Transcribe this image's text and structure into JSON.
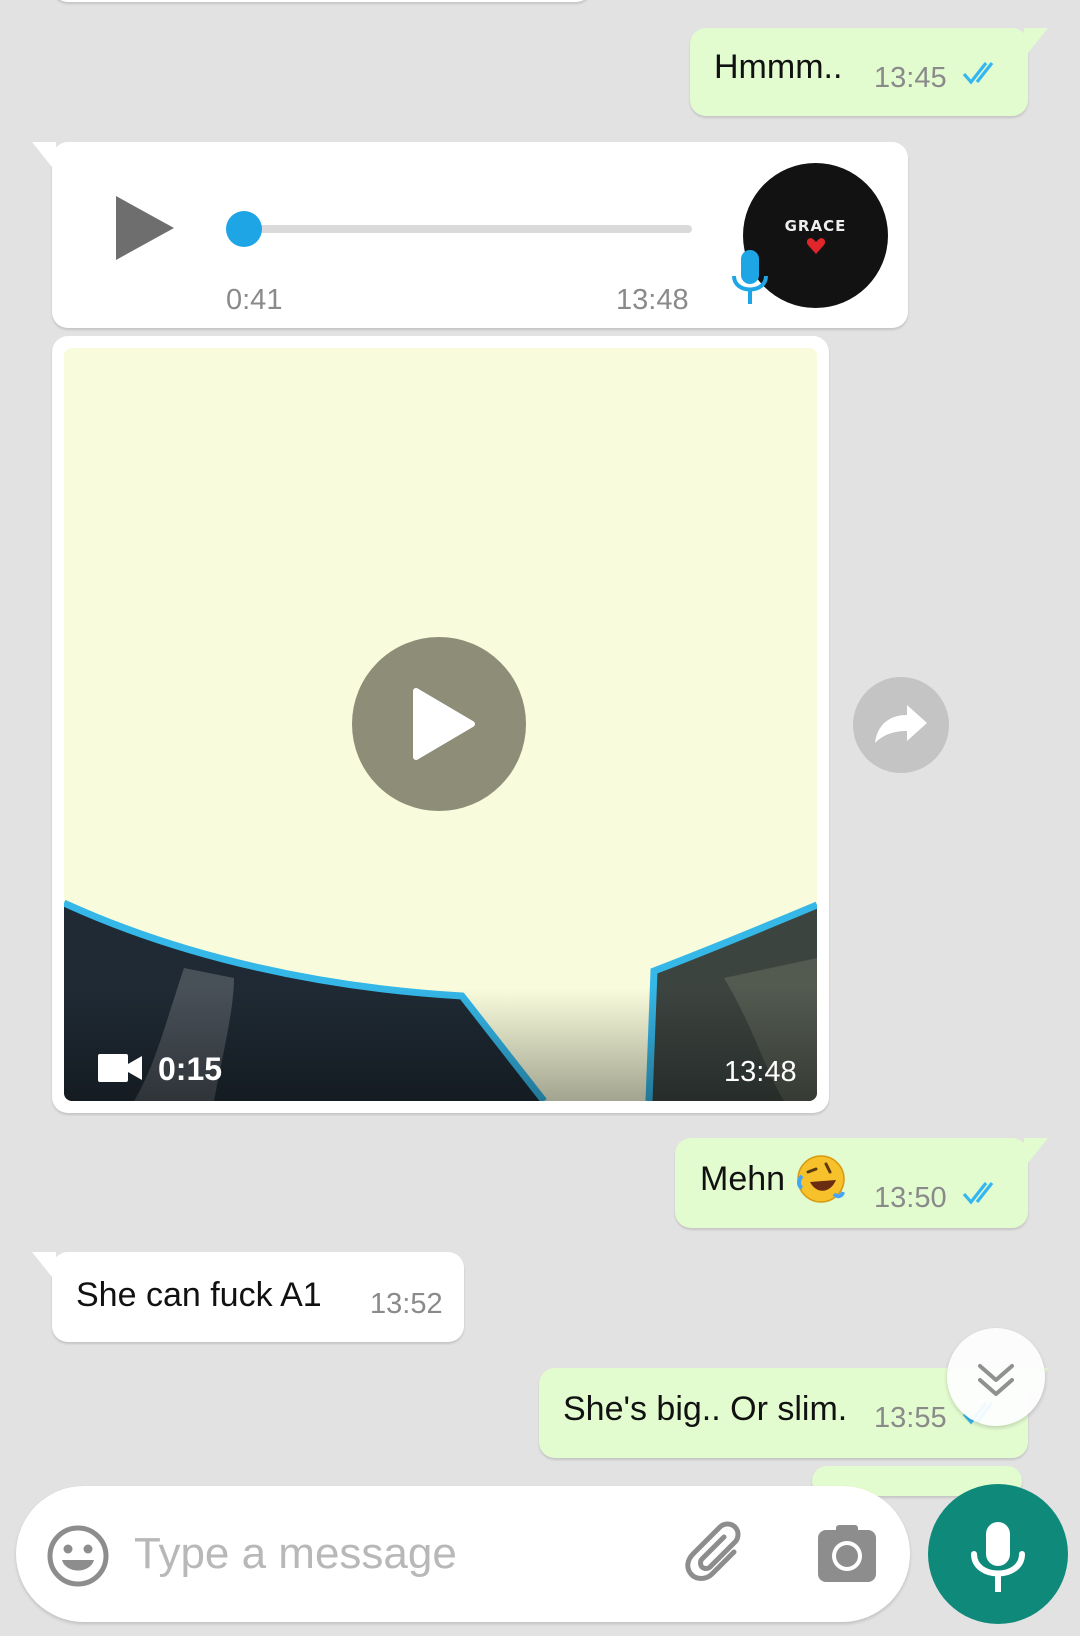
{
  "colors": {
    "background": "#e2e2e2",
    "incoming_bubble": "#ffffff",
    "outgoing_bubble": "#e2fbcf",
    "read_ticks": "#34b7f1",
    "audio_progress": "#1ea5e6",
    "mic_button": "#0f8a7a"
  },
  "messages": {
    "m1": {
      "text": "Hmmm..",
      "time": "13:45",
      "status": "read"
    },
    "m2": {
      "type": "voice_note",
      "position": "0:41",
      "time": "13:48",
      "progress": 0.0,
      "avatar_text": "GRACE",
      "avatar_icon": "heart-icon"
    },
    "m3": {
      "type": "video",
      "duration": "0:15",
      "time": "13:48",
      "icon": "video-camera-icon"
    },
    "m4": {
      "text": "Mehn",
      "emoji": "rolling-on-floor-laughing-emoji",
      "time": "13:50",
      "status": "read"
    },
    "m5": {
      "text": "She can fuck A1",
      "time": "13:52"
    },
    "m6": {
      "text": "She's big.. Or slim.",
      "time": "13:55",
      "status": "read"
    }
  },
  "composer": {
    "placeholder": "Type a message",
    "icons": [
      "smiley-icon",
      "paperclip-icon",
      "camera-icon",
      "microphone-icon"
    ]
  },
  "floating": {
    "share_icon": "forward-arrow-icon",
    "scroll_icon": "double-chevron-down-icon"
  }
}
